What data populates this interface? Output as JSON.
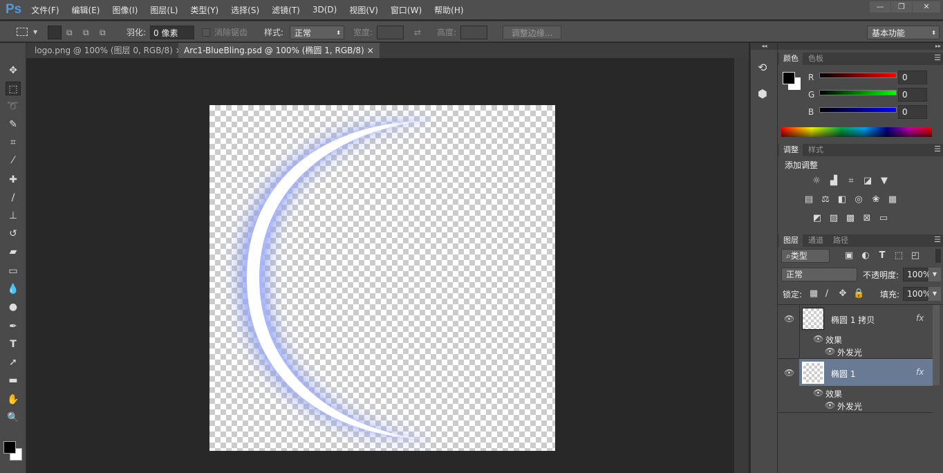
{
  "app": {
    "logo": "Ps",
    "window_controls": [
      "—",
      "❐",
      "✕"
    ]
  },
  "menu": [
    "文件(F)",
    "编辑(E)",
    "图像(I)",
    "图层(L)",
    "类型(Y)",
    "选择(S)",
    "滤镜(T)",
    "3D(D)",
    "视图(V)",
    "窗口(W)",
    "帮助(H)"
  ],
  "options": {
    "feather_label": "羽化:",
    "feather_value": "0 像素",
    "antialias_label": "消除锯齿",
    "style_label": "样式:",
    "style_value": "正常",
    "width_label": "宽度:",
    "height_label": "高度:",
    "refine_edge": "调整边缘...",
    "workspace": "基本功能"
  },
  "tabs": [
    {
      "label": "logo.png @ 100% (图层 0, RGB/8)",
      "close": "×"
    },
    {
      "label": "Arc1-BlueBling.psd @ 100% (椭圆 1, RGB/8)",
      "close": "×"
    }
  ],
  "color_panel": {
    "tabs": [
      "颜色",
      "色板"
    ],
    "channels": [
      {
        "label": "R",
        "value": "0",
        "color": "#ff0000"
      },
      {
        "label": "G",
        "value": "0",
        "color": "#00ff00"
      },
      {
        "label": "B",
        "value": "0",
        "color": "#0000ff"
      }
    ]
  },
  "adjust_panel": {
    "tabs": [
      "调整",
      "样式"
    ],
    "title": "添加调整"
  },
  "layers_panel": {
    "tabs": [
      "图层",
      "通道",
      "路径"
    ],
    "filter": "类型",
    "blend": "正常",
    "opacity_label": "不透明度:",
    "opacity": "100%",
    "lock_label": "锁定:",
    "fill_label": "填充:",
    "fill": "100%",
    "layers": [
      {
        "name": "椭圆 1 拷贝",
        "fx": "fx",
        "effects_label": "效果",
        "effect": "外发光",
        "selected": false
      },
      {
        "name": "椭圆 1",
        "fx": "fx",
        "effects_label": "效果",
        "effect": "外发光",
        "selected": true
      }
    ]
  }
}
